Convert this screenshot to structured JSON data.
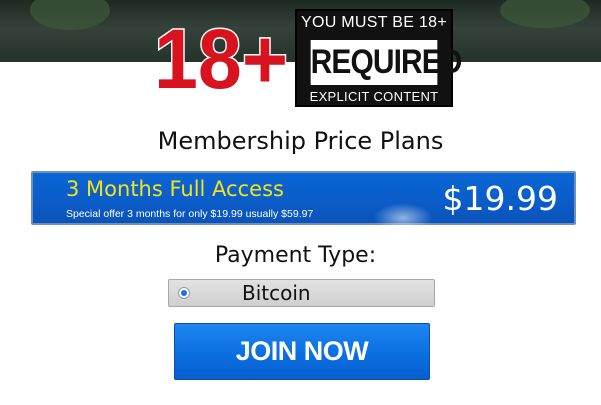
{
  "banner": {
    "age_number": "18+",
    "warn_top": "YOU MUST BE 18+",
    "warn_main": "REQUIRED",
    "warn_bottom": "EXPLICIT CONTENT"
  },
  "plans": {
    "title": "Membership Price Plans",
    "plan": {
      "name": "3 Months Full Access",
      "subtitle": "Special offer 3 months for only $19.99 usually $59.97",
      "price": "$19.99"
    }
  },
  "payment": {
    "title": "Payment Type:",
    "option": "Bitcoin",
    "selected": true
  },
  "cta": {
    "label": "JOIN NOW"
  },
  "colors": {
    "accent_blue": "#0b5cc8",
    "plan_name_yellow": "#f4e21c",
    "badge_red": "#d7131f"
  }
}
